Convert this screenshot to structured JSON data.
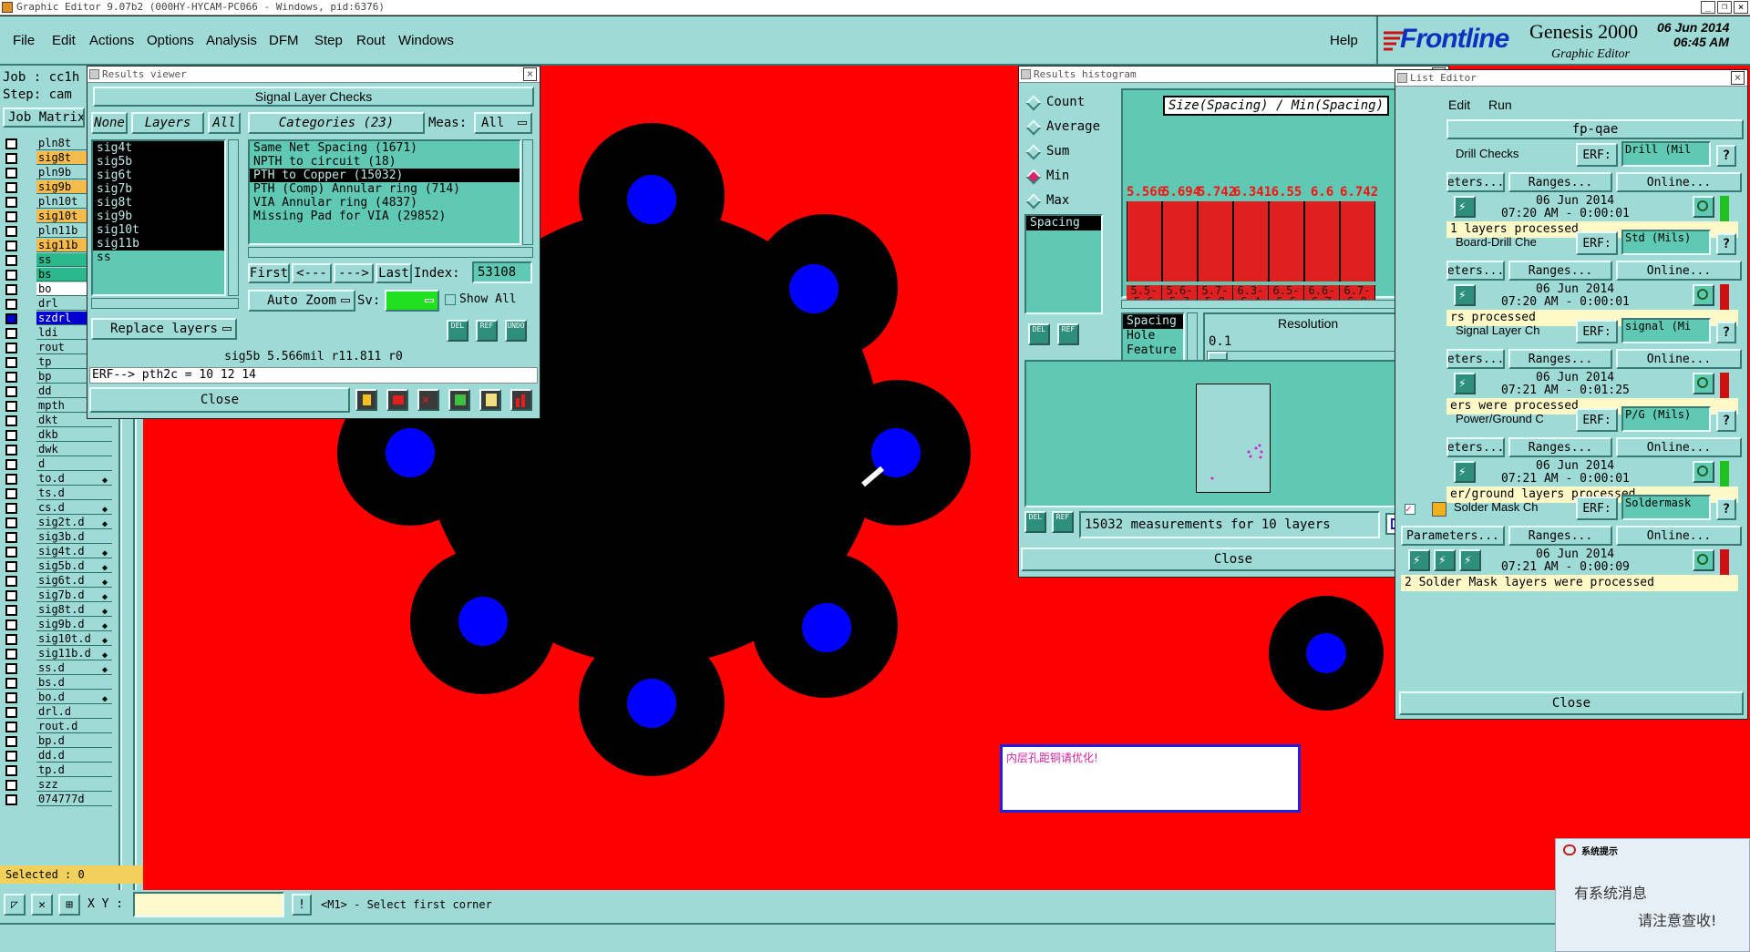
{
  "titlebar": {
    "title": "Graphic Editor 9.07b2  (000HY-HYCAM-PC066 - Windows, pid:6376)",
    "controls": [
      "_",
      "❐",
      "×"
    ]
  },
  "menu": {
    "items": [
      "File",
      "Edit",
      "Actions",
      "Options",
      "Analysis",
      "DFM",
      "Step",
      "Rout",
      "Windows"
    ],
    "help": "Help"
  },
  "brand": {
    "logo": "Frontline",
    "product": "Genesis 2000",
    "subtitle": "Graphic Editor",
    "date": "06 Jun 2014",
    "time": "06:45 AM"
  },
  "left_panel": {
    "job_label": "Job : cc1h",
    "step_label": "Step: cam",
    "matrix_label": "Job Matrix",
    "layers": [
      {
        "name": "pln8t",
        "style": "plain"
      },
      {
        "name": "sig8t",
        "style": "sel"
      },
      {
        "name": "pln9b",
        "style": "plain"
      },
      {
        "name": "sig9b",
        "style": "sel"
      },
      {
        "name": "pln10t",
        "style": "plain"
      },
      {
        "name": "sig10t",
        "style": "sel"
      },
      {
        "name": "pln11b",
        "style": "plain"
      },
      {
        "name": "sig11b",
        "style": "sel"
      },
      {
        "name": "ss",
        "style": "grn"
      },
      {
        "name": "bs",
        "style": "grn"
      },
      {
        "name": "bo",
        "style": "wht"
      },
      {
        "name": "drl",
        "style": "plain"
      },
      {
        "name": "szdrl",
        "style": "blu"
      },
      {
        "name": "ldi",
        "style": "plain"
      },
      {
        "name": "rout",
        "style": "plain"
      },
      {
        "name": "tp",
        "style": "plain"
      },
      {
        "name": "bp",
        "style": "plain"
      },
      {
        "name": "dd",
        "style": "plain"
      },
      {
        "name": "mpth",
        "style": "plain"
      },
      {
        "name": "dkt",
        "style": "plain"
      },
      {
        "name": "dkb",
        "style": "plain"
      },
      {
        "name": "dwk",
        "style": "plain"
      },
      {
        "name": "d",
        "style": "plain"
      },
      {
        "name": "to.d",
        "style": "mark"
      },
      {
        "name": "ts.d",
        "style": "plain"
      },
      {
        "name": "cs.d",
        "style": "mark"
      },
      {
        "name": "sig2t.d",
        "style": "mark"
      },
      {
        "name": "sig3b.d",
        "style": "plain"
      },
      {
        "name": "sig4t.d",
        "style": "mark"
      },
      {
        "name": "sig5b.d",
        "style": "mark"
      },
      {
        "name": "sig6t.d",
        "style": "mark"
      },
      {
        "name": "sig7b.d",
        "style": "mark"
      },
      {
        "name": "sig8t.d",
        "style": "mark"
      },
      {
        "name": "sig9b.d",
        "style": "mark"
      },
      {
        "name": "sig10t.d",
        "style": "mark"
      },
      {
        "name": "sig11b.d",
        "style": "mark"
      },
      {
        "name": "ss.d",
        "style": "mark"
      },
      {
        "name": "bs.d",
        "style": "plain"
      },
      {
        "name": "bo.d",
        "style": "mark"
      },
      {
        "name": "drl.d",
        "style": "plain"
      },
      {
        "name": "rout.d",
        "style": "plain"
      },
      {
        "name": "bp.d",
        "style": "plain"
      },
      {
        "name": "dd.d",
        "style": "plain"
      },
      {
        "name": "tp.d",
        "style": "plain"
      },
      {
        "name": "szz",
        "style": "plain"
      },
      {
        "name": "074777d",
        "style": "plain"
      }
    ],
    "selected": "Selected : 0"
  },
  "results_viewer": {
    "title": "Results viewer",
    "header": "Signal Layer Checks",
    "none_btn": "None",
    "layers_btn": "Layers",
    "all_btn": "All",
    "categories_btn": "Categories (23)",
    "meas_label": "Meas:",
    "meas_value": "All",
    "layer_list": [
      "sig4t",
      "sig5b",
      "sig6t",
      "sig7b",
      "sig8t",
      "sig9b",
      "sig10t",
      "sig11b",
      "ss"
    ],
    "categories": [
      "Same Net Spacing (1671)",
      "NPTH to circuit (18)",
      "PTH to Copper (15032)",
      "PTH (Comp) Annular ring (714)",
      "VIA Annular ring (4837)",
      "Missing Pad for VIA (29852)"
    ],
    "nav": {
      "first": "First",
      "prev": "<---",
      "next": "--->",
      "last": "Last",
      "index_label": "Index:",
      "index_value": "53108"
    },
    "auto_zoom": "Auto Zoom",
    "sv_label": "Sv:",
    "show_all": "Show All",
    "replace_layers": "Replace layers",
    "icon_labels": [
      "DEL",
      "REF",
      "UNDO"
    ],
    "status": "sig5b 5.566mil  r11.811  r0",
    "erf": "ERF--> pth2c = 10 12 14",
    "close": "Close"
  },
  "histogram": {
    "title": "Results histogram",
    "radios": [
      {
        "label": "Count",
        "on": false
      },
      {
        "label": "Average",
        "on": false
      },
      {
        "label": "Sum",
        "on": false
      },
      {
        "label": "Min",
        "on": true
      },
      {
        "label": "Max",
        "on": false
      }
    ],
    "spacing_label": "Spacing",
    "chart_title": "Size(Spacing) / Min(Spacing)",
    "list2": [
      "Spacing",
      "Hole",
      "Feature"
    ],
    "resolution_label": "Resolution",
    "resolution_value": "0.1",
    "measurements": "15032 measurements for 10 layers",
    "close": "Close",
    "icon_labels": [
      "DEL",
      "REF"
    ],
    "accent": "#e02020"
  },
  "chart_data": {
    "type": "bar",
    "title": "Size(Spacing) / Min(Spacing)",
    "categories": [
      "5.5-5.6",
      "5.6-5.7",
      "5.7-5.8",
      "6.3-6.4",
      "6.5-6.6",
      "6.6-6.7",
      "6.7-6.8"
    ],
    "bins": [
      [
        "5.5-",
        "5.6"
      ],
      [
        "5.6-",
        "5.7"
      ],
      [
        "5.7-",
        "5.8"
      ],
      [
        "6.3-",
        "6.4"
      ],
      [
        "6.5-",
        "6.6"
      ],
      [
        "6.6-",
        "6.7"
      ],
      [
        "6.7-",
        "6.8"
      ]
    ],
    "value_labels": [
      "5.566",
      "5.694",
      "5.742",
      "6.341",
      "6.55",
      "6.6",
      "6.742"
    ],
    "values": [
      5.566,
      5.694,
      5.742,
      6.341,
      6.55,
      6.6,
      6.742
    ],
    "heights": [
      1,
      1,
      1,
      1,
      1,
      1,
      1
    ],
    "ylim": [
      0,
      1.3
    ]
  },
  "list_editor": {
    "title": "List Editor",
    "menu": [
      "Edit",
      "Run"
    ],
    "name": "fp-qae",
    "checks": [
      {
        "name": "Drill Checks",
        "erf": "ERF:",
        "erf_value": "Drill (Mil",
        "date": "06 Jun 2014",
        "time": "07:20 AM - 0:00:01",
        "status": "1 layers processed",
        "state": "green"
      },
      {
        "name": "Board-Drill Che",
        "erf": "ERF:",
        "erf_value": "Std (Mils)",
        "date": "06 Jun 2014",
        "time": "07:20 AM - 0:00:01",
        "status": "rs processed",
        "state": "red"
      },
      {
        "name": "Signal Layer Ch",
        "erf": "ERF:",
        "erf_value": "signal (Mi",
        "date": "06 Jun 2014",
        "time": "07:21 AM - 0:01:25",
        "status": "ers were processed",
        "state": "red"
      },
      {
        "name": "Power/Ground C",
        "erf": "ERF:",
        "erf_value": "P/G (Mils)",
        "date": "06 Jun 2014",
        "time": "07:21 AM - 0:00:01",
        "status": "er/ground layers processed",
        "state": "green"
      },
      {
        "name": "Solder Mask Ch",
        "erf": "ERF:",
        "erf_value": "Soldermask",
        "date": "06 Jun 2014",
        "time": "07:21 AM - 0:00:09",
        "status": "2 Solder Mask layers were processed",
        "state": "red"
      }
    ],
    "params": "Parameters...",
    "params_short": "eters...",
    "ranges": "Ranges...",
    "online": "Online...",
    "help": "?",
    "close": "Close"
  },
  "canvas": {
    "note": "内层孔距铜请优化!",
    "bg": "#ff0000",
    "pad_color": "#0000ff"
  },
  "bottom": {
    "xy_label": "X Y :",
    "prompt": "<M1> - Select first corner"
  },
  "popup": {
    "title": "系统提示",
    "line1": "有系统消息",
    "line2": "请注意查收!"
  }
}
